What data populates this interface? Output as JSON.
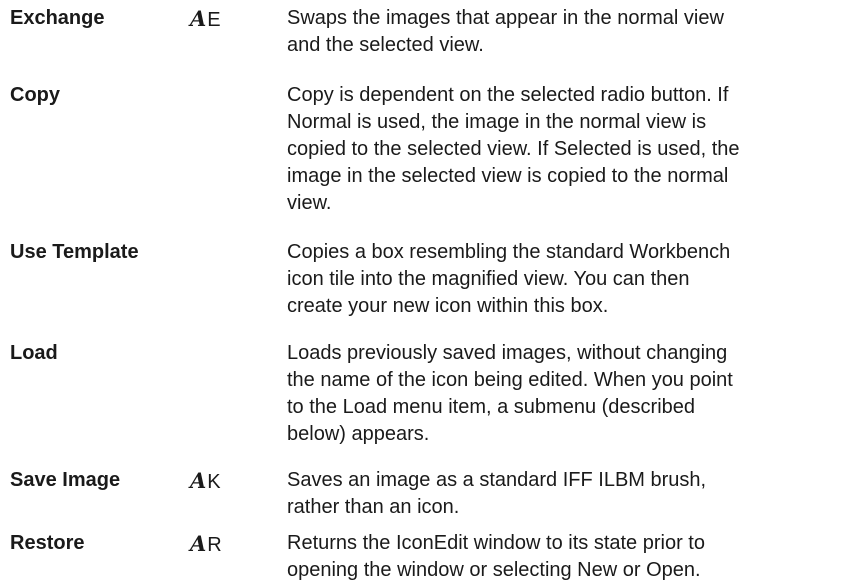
{
  "amiga_key_symbol": "A",
  "amiga_key_icon": "amiga-key-icon",
  "entries": [
    {
      "term": "Exchange",
      "shortcut_key": "E",
      "description": "Swaps the images that appear in the normal view\nand the selected view."
    },
    {
      "term": "Copy",
      "shortcut_key": "",
      "description": "Copy is dependent on the selected radio button.  If\nNormal is used, the image in the normal view is\ncopied to the selected view.  If Selected is used, the\nimage in the selected view is copied to the normal\nview."
    },
    {
      "term": "Use Template",
      "shortcut_key": "",
      "description": "Copies a box resembling the standard Workbench\nicon tile into the magnified view.  You can then\ncreate your new icon within this box."
    },
    {
      "term": "Load",
      "shortcut_key": "",
      "description": "Loads previously saved images, without changing\nthe name of the icon being edited.  When you point\nto the Load menu item, a submenu (described\nbelow) appears."
    },
    {
      "term": "Save Image",
      "shortcut_key": "K",
      "description": "Saves an image as a standard IFF ILBM brush,\nrather than an icon."
    },
    {
      "term": "Restore",
      "shortcut_key": "R",
      "description": "Returns the IconEdit window to its state prior to\nopening the window or selecting New or Open."
    }
  ]
}
